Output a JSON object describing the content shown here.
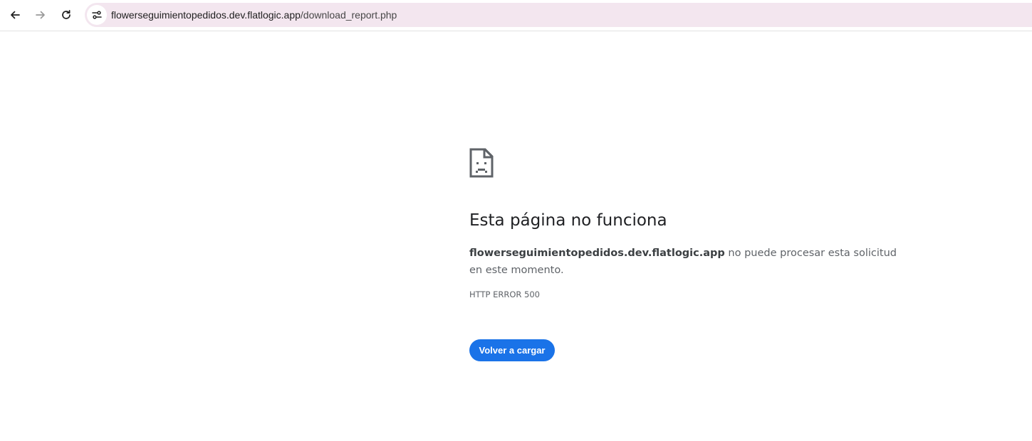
{
  "browser": {
    "address_bar": {
      "host": "flowerseguimientopedidos.dev.flatlogic.app",
      "path": "/download_report.php"
    },
    "icons": {
      "back": "arrow-left-icon",
      "forward": "arrow-right-icon",
      "reload": "reload-icon",
      "site_info": "tune-icon"
    }
  },
  "error_page": {
    "title": "Esta página no funciona",
    "description_host": "flowerseguimientopedidos.dev.flatlogic.app",
    "description_rest": " no puede procesar esta solicitud en este momento.",
    "error_code": "HTTP ERROR 500",
    "reload_label": "Volver a cargar",
    "icon": "sad-page-icon"
  },
  "colors": {
    "omnibox_bg": "#f3e6ef",
    "button_bg": "#1a73e8",
    "title_text": "#202124",
    "body_text": "#5f6368"
  }
}
